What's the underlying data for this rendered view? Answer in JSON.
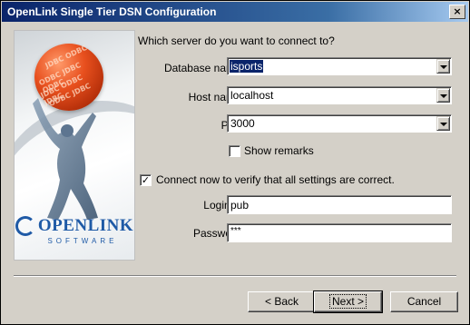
{
  "window": {
    "title": "OpenLink Single Tier DSN Configuration",
    "close_glyph": "×"
  },
  "banner": {
    "logo_text": "OPENLINK",
    "logo_subtext": "SOFTWARE",
    "ball_text": [
      "JDBC ODBC",
      "ODBC JDBC ODBC",
      "JDBC ODBC JDBC",
      "ODBC JDBC"
    ]
  },
  "form": {
    "question": "Which server do you want to connect to?",
    "database": {
      "label": "Database name:",
      "value": "isports"
    },
    "host": {
      "label": "Host name:",
      "value": "localhost"
    },
    "port": {
      "label": "Port:",
      "value": "3000"
    },
    "show_remarks": {
      "label": "Show remarks",
      "checked": false,
      "mark": ""
    },
    "connect_now": {
      "label": "Connect now to verify that all settings are correct.",
      "checked": true,
      "mark": "✓"
    },
    "login": {
      "label": "Login ID",
      "value": "pub"
    },
    "password": {
      "label": "Password:",
      "value": "***"
    }
  },
  "buttons": {
    "back_label": "< Back",
    "next_label": "Next >",
    "cancel_label": "Cancel"
  }
}
